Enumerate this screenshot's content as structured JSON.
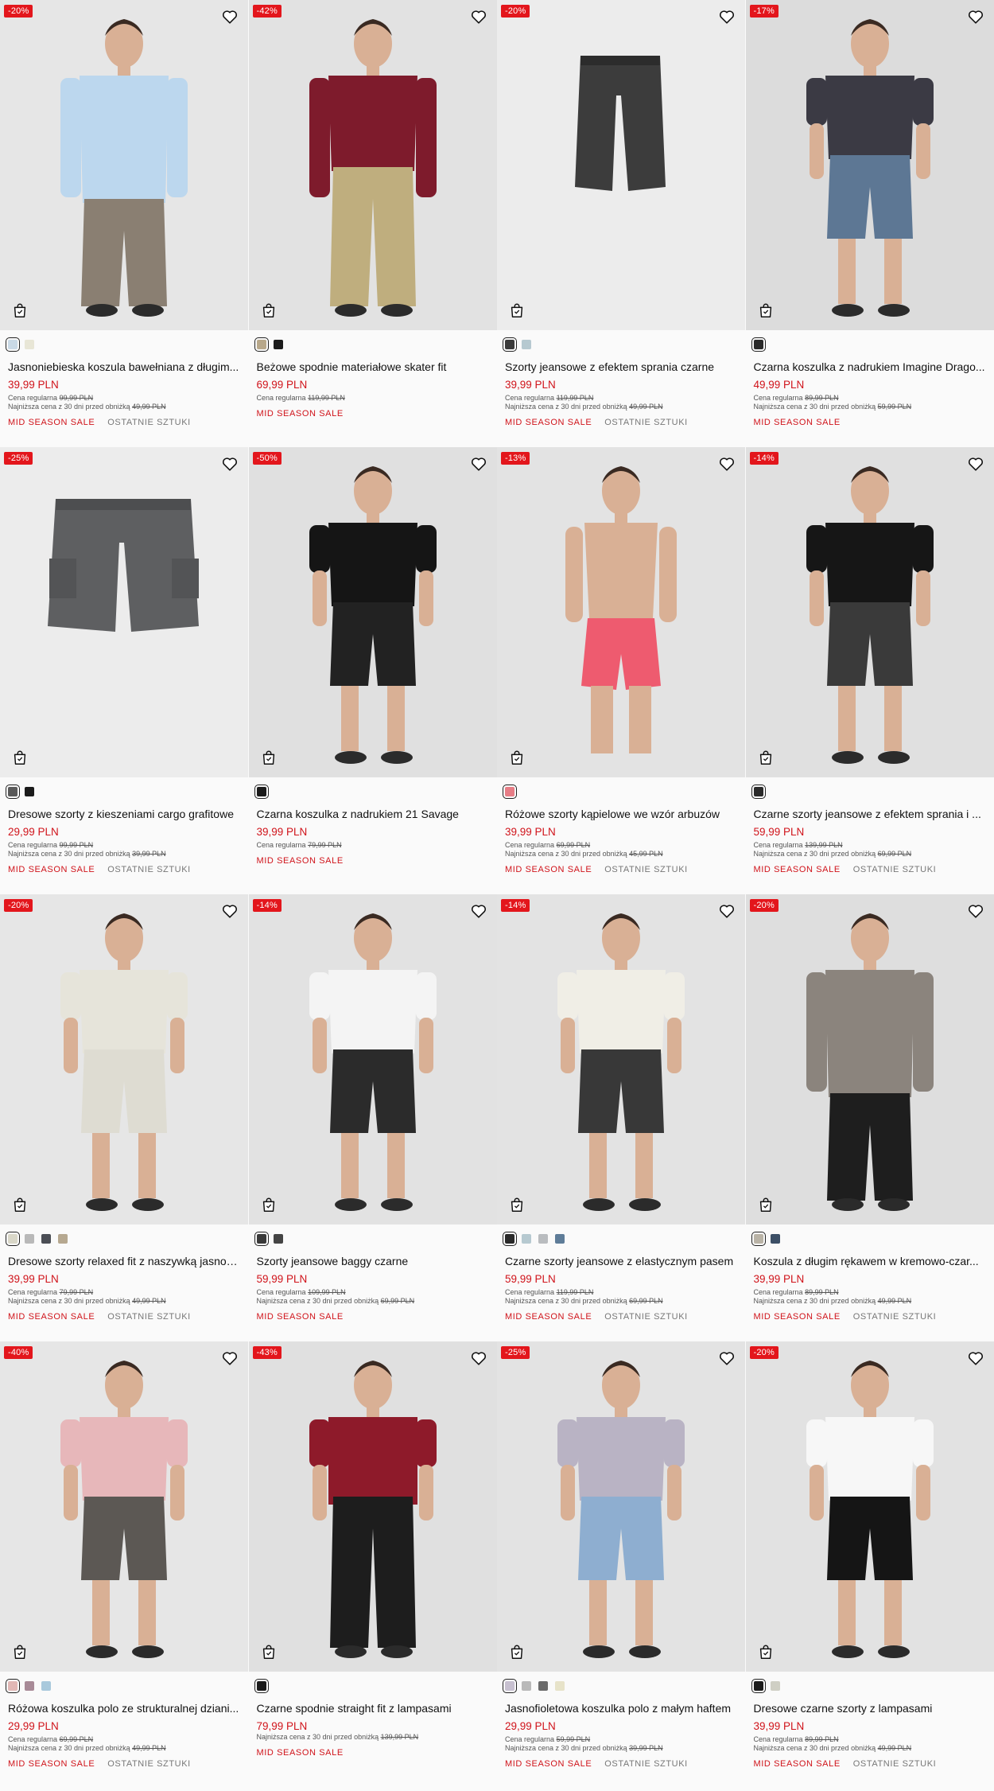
{
  "labels": {
    "regular_prefix": "Cena regularna",
    "lowest_prefix": "Najniższa cena z 30 dni przed obniżką",
    "sale_tag": "MID SEASON SALE",
    "last_tag": "OSTATNIE SZTUKI"
  },
  "icons": {
    "favorite": "heart-icon",
    "add_to_bag": "bag-icon"
  },
  "colors": {
    "accent": "#d0131a",
    "badge": "#e3161c"
  },
  "products": [
    {
      "discount": "-20%",
      "title": "Jasnoniebieska koszula bawełniana z długim...",
      "price": "39,99 PLN",
      "regular": "99,99 PLN",
      "lowest": "49,99 PLN",
      "last": true,
      "swatches": [
        "#c9d9e6",
        "#e8e6d6"
      ],
      "bg": "#e6e6e6",
      "fig": "shirt-man",
      "c1": "#bcd7ee",
      "c2": "#8a7f72"
    },
    {
      "discount": "-42%",
      "title": "Beżowe spodnie materiałowe skater fit",
      "price": "69,99 PLN",
      "regular": "119,99 PLN",
      "lowest": "",
      "last": false,
      "swatches": [
        "#b8a88a",
        "#1b1b1b"
      ],
      "bg": "#e2e2e2",
      "fig": "hoodie-man",
      "c1": "#7e1b2c",
      "c2": "#bfae7e"
    },
    {
      "discount": "-20%",
      "title": "Szorty jeansowe z efektem sprania czarne",
      "price": "39,99 PLN",
      "regular": "119,99 PLN",
      "lowest": "49,99 PLN",
      "last": true,
      "swatches": [
        "#3a3a3a",
        "#b6c9d0"
      ],
      "bg": "#ececec",
      "fig": "shorts",
      "c1": "#3c3c3c",
      "c2": "#3c3c3c"
    },
    {
      "discount": "-17%",
      "title": "Czarna koszulka z nadrukiem Imagine Drago...",
      "price": "49,99 PLN",
      "regular": "89,99 PLN",
      "lowest": "59,99 PLN",
      "last": false,
      "swatches": [
        "#2a2a2a"
      ],
      "bg": "#dcdcdc",
      "fig": "tee-man",
      "c1": "#3b3a44",
      "c2": "#5d7794"
    },
    {
      "discount": "-25%",
      "title": "Dresowe szorty z kieszeniami cargo grafitowe",
      "price": "29,99 PLN",
      "regular": "99,99 PLN",
      "lowest": "39,99 PLN",
      "last": true,
      "swatches": [
        "#5a5a5a",
        "#1b1b1b"
      ],
      "bg": "#ececec",
      "fig": "cargo-shorts",
      "c1": "#5e5f61",
      "c2": "#5e5f61"
    },
    {
      "discount": "-50%",
      "title": "Czarna koszulka z nadrukiem 21 Savage",
      "price": "39,99 PLN",
      "regular": "79,99 PLN",
      "lowest": "",
      "last": false,
      "swatches": [
        "#1b1b1b"
      ],
      "bg": "#e0e0e0",
      "fig": "tee-man",
      "c1": "#151515",
      "c2": "#222222"
    },
    {
      "discount": "-13%",
      "title": "Różowe szorty kąpielowe we wzór arbuzów",
      "price": "39,99 PLN",
      "regular": "69,99 PLN",
      "lowest": "45,99 PLN",
      "last": true,
      "swatches": [
        "#e77d86"
      ],
      "bg": "#e3e3e3",
      "fig": "swim-man",
      "c1": "#d9a88c",
      "c2": "#ee5b6f"
    },
    {
      "discount": "-14%",
      "title": "Czarne szorty jeansowe z efektem sprania i ...",
      "price": "59,99 PLN",
      "regular": "139,99 PLN",
      "lowest": "69,99 PLN",
      "last": true,
      "swatches": [
        "#2a2a2a"
      ],
      "bg": "#e0e0e0",
      "fig": "tee-man",
      "c1": "#161616",
      "c2": "#3a3a3a"
    },
    {
      "discount": "-20%",
      "title": "Dresowe szorty relaxed fit z naszywką jasnos...",
      "price": "39,99 PLN",
      "regular": "79,99 PLN",
      "lowest": "49,99 PLN",
      "last": true,
      "swatches": [
        "#d9d7c8",
        "#b9b9b9",
        "#4b4e55",
        "#b6a890"
      ],
      "bg": "#e6e6e6",
      "fig": "tee-man-dark",
      "c1": "#e6e4da",
      "c2": "#dedcd2"
    },
    {
      "discount": "-14%",
      "title": "Szorty jeansowe baggy czarne",
      "price": "59,99 PLN",
      "regular": "109,99 PLN",
      "lowest": "69,99 PLN",
      "last": false,
      "swatches": [
        "#3a3a3a",
        "#444444"
      ],
      "bg": "#e2e2e2",
      "fig": "tee-man",
      "c1": "#f4f4f4",
      "c2": "#2b2b2b"
    },
    {
      "discount": "-14%",
      "title": "Czarne szorty jeansowe z elastycznym pasem",
      "price": "59,99 PLN",
      "regular": "119,99 PLN",
      "lowest": "69,99 PLN",
      "last": true,
      "swatches": [
        "#2a2a2a",
        "#b6c9d0",
        "#b9bcbf",
        "#5e7c98"
      ],
      "bg": "#e3e3e3",
      "fig": "tee-man",
      "c1": "#f0eee6",
      "c2": "#383838"
    },
    {
      "discount": "-20%",
      "title": "Koszula z długim rękawem w kremowo-czar...",
      "price": "39,99 PLN",
      "regular": "89,99 PLN",
      "lowest": "49,99 PLN",
      "last": true,
      "swatches": [
        "#b9b3a6",
        "#3c4f66"
      ],
      "bg": "#dedede",
      "fig": "shirt-man",
      "c1": "#8b847d",
      "c2": "#1e1e1e"
    },
    {
      "discount": "-40%",
      "title": "Różowa koszulka polo ze strukturalnej dziani...",
      "price": "29,99 PLN",
      "regular": "69,99 PLN",
      "lowest": "49,99 PLN",
      "last": true,
      "swatches": [
        "#e1b7b5",
        "#a88a97",
        "#a9c9dc"
      ],
      "bg": "#e6e6e6",
      "fig": "polo-man",
      "c1": "#e7b7ba",
      "c2": "#5c5854"
    },
    {
      "discount": "-43%",
      "title": "Czarne spodnie straight fit z lampasami",
      "price": "79,99 PLN",
      "regular": "",
      "lowest": "139,99 PLN",
      "last": false,
      "swatches": [
        "#1b1b1b"
      ],
      "bg": "#e0e0e0",
      "fig": "vest-man",
      "c1": "#8e1a2a",
      "c2": "#1d1d1d"
    },
    {
      "discount": "-25%",
      "title": "Jasnofioletowa koszulka polo z małym haftem",
      "price": "29,99 PLN",
      "regular": "59,99 PLN",
      "lowest": "39,99 PLN",
      "last": true,
      "swatches": [
        "#c7c0d0",
        "#b9b9b9",
        "#6b6b6b",
        "#e7e3c9"
      ],
      "bg": "#e3e3e3",
      "fig": "polo-man",
      "c1": "#b9b3c4",
      "c2": "#8eaed0"
    },
    {
      "discount": "-20%",
      "title": "Dresowe czarne szorty z lampasami",
      "price": "39,99 PLN",
      "regular": "89,99 PLN",
      "lowest": "49,99 PLN",
      "last": true,
      "swatches": [
        "#1b1b1b",
        "#cfcfc4"
      ],
      "bg": "#e2e2e2",
      "fig": "tee-man",
      "c1": "#f7f7f7",
      "c2": "#151515"
    }
  ]
}
